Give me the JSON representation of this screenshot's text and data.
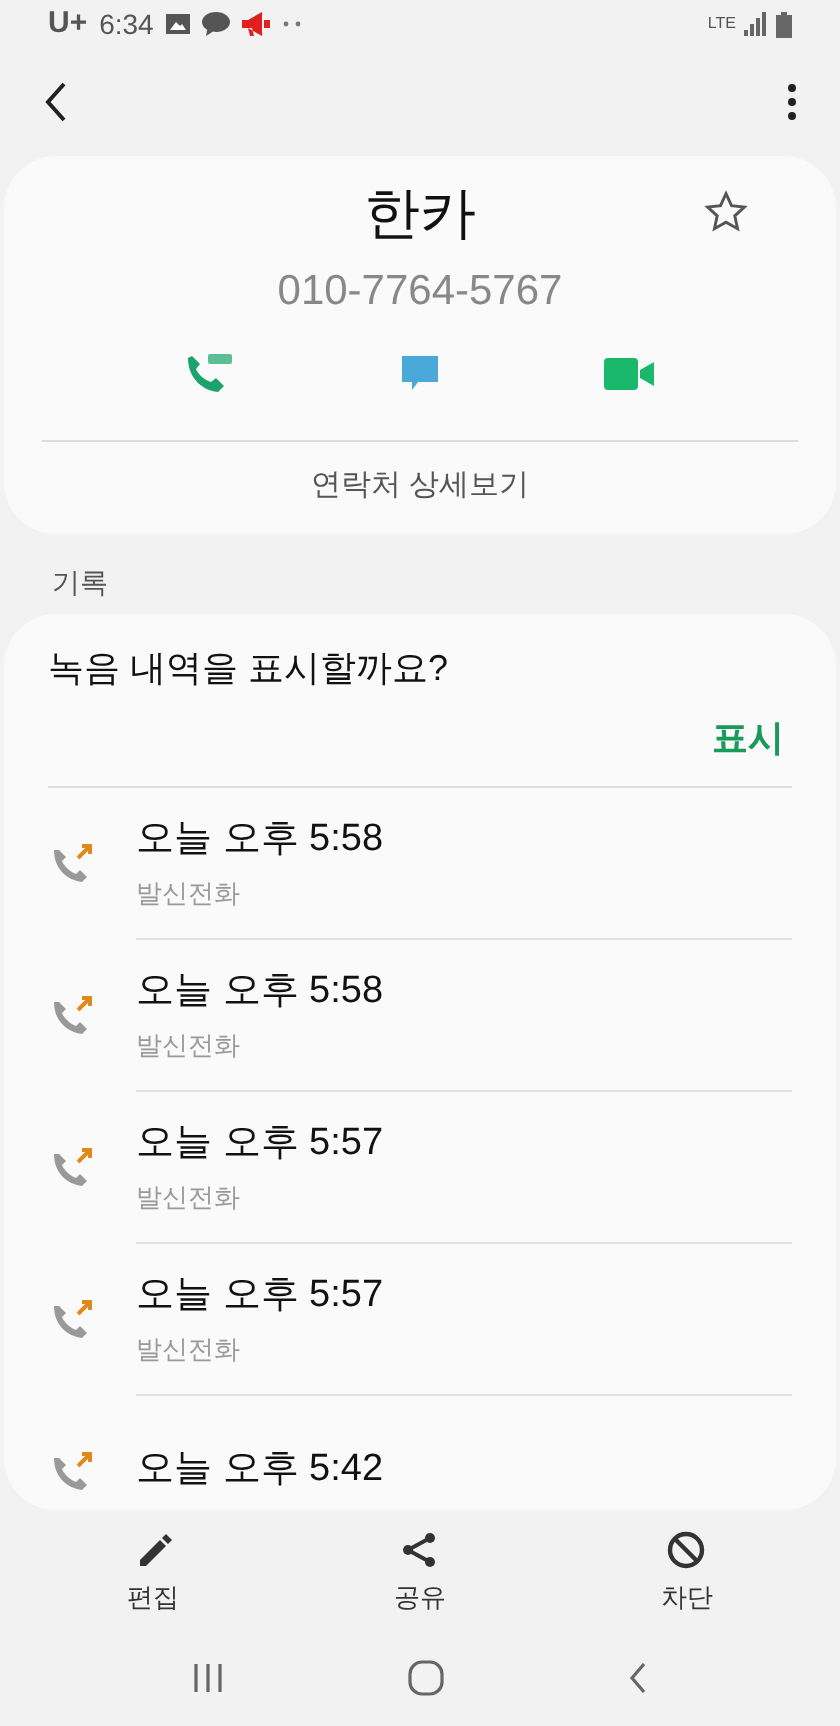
{
  "status_bar": {
    "carrier": "U+",
    "time": "6:34",
    "network": "LTE"
  },
  "contact": {
    "name": "한카",
    "phone": "010-7764-5767",
    "favorite": false,
    "details_link": "연락처 상세보기"
  },
  "history": {
    "heading": "기록",
    "prompt": "녹음 내역을 표시할까요?",
    "show_button": "표시",
    "calls": [
      {
        "time": "오늘 오후 5:58",
        "type": "발신전화"
      },
      {
        "time": "오늘 오후 5:58",
        "type": "발신전화"
      },
      {
        "time": "오늘 오후 5:57",
        "type": "발신전화"
      },
      {
        "time": "오늘 오후 5:57",
        "type": "발신전화"
      },
      {
        "time": "오늘 오후 5:42"
      }
    ]
  },
  "actions": [
    {
      "kind": "edit",
      "label": "편집"
    },
    {
      "kind": "share",
      "label": "공유"
    },
    {
      "kind": "block",
      "label": "차단"
    }
  ]
}
